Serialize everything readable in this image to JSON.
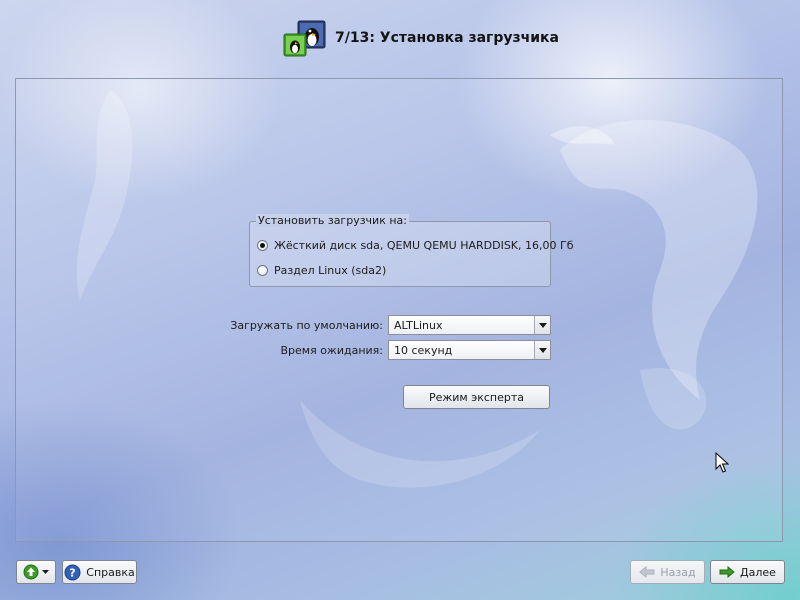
{
  "header": {
    "title": "7/13: Установка загрузчика",
    "logo_icon": "penguin-logo-icon"
  },
  "bootloader_target": {
    "group_title": "Установить загрузчик на:",
    "options": [
      {
        "label": "Жёсткий диск sda, QEMU QEMU HARDDISK, 16,00 Гб",
        "selected": true
      },
      {
        "label": "Раздел Linux (sda2)",
        "selected": false
      }
    ]
  },
  "settings": {
    "default_boot_label": "Загружать по умолчанию:",
    "default_boot_value": "ALTLinux",
    "timeout_label": "Время ожидания:",
    "timeout_value": "10 секунд"
  },
  "expert_button_label": "Режим эксперта",
  "footer": {
    "menu_button_icon": "green-circle-arrow-icon",
    "help_label": "Справка",
    "help_icon": "question-mark-icon",
    "back_label": "Назад",
    "back_enabled": false,
    "next_label": "Далее",
    "next_icon": "green-arrow-right-icon"
  },
  "colors": {
    "accent_green": "#3f9b2a",
    "help_blue": "#2f62b8",
    "frame_border": "#8d97ad"
  }
}
